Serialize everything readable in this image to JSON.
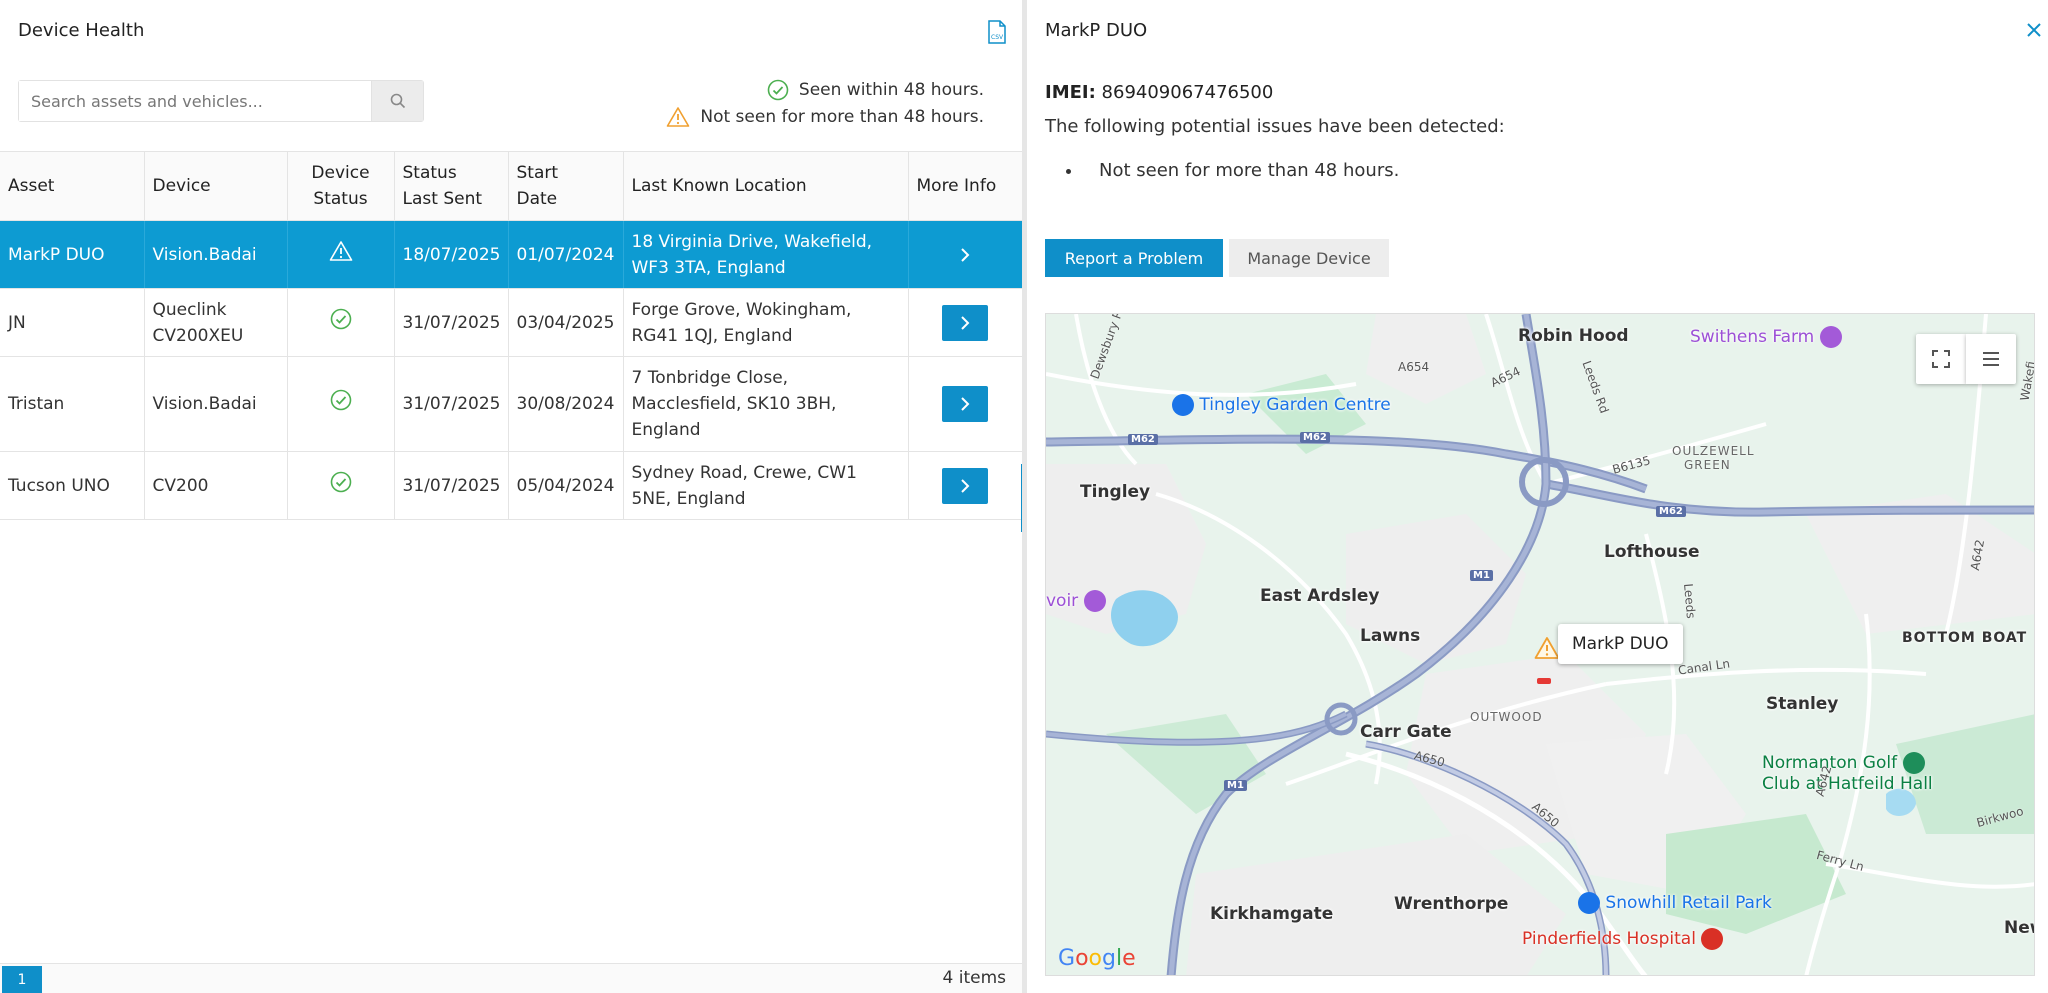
{
  "left": {
    "title": "Device Health",
    "search_placeholder": "Search assets and vehicles...",
    "legend": {
      "seen": "Seen within 48 hours.",
      "not_seen": "Not seen for more than 48 hours."
    },
    "columns": {
      "asset": "Asset",
      "device": "Device",
      "device_status_1": "Device",
      "device_status_2": "Status",
      "status_last_sent_1": "Status",
      "status_last_sent_2": "Last Sent",
      "start_date_1": "Start",
      "start_date_2": "Date",
      "last_known_location": "Last Known Location",
      "more_info": "More Info"
    },
    "rows": [
      {
        "asset": "MarkP DUO",
        "device": "Vision.Badai",
        "status": "warning",
        "last_sent": "18/07/2025",
        "start_date": "01/07/2024",
        "location": "18 Virginia Drive, Wakefield, WF3 3TA, England"
      },
      {
        "asset": "JN",
        "device": "Queclink CV200XEU",
        "status": "ok",
        "last_sent": "31/07/2025",
        "start_date": "03/04/2025",
        "location": "Forge Grove, Wokingham, RG41 1QJ, England"
      },
      {
        "asset": "Tristan",
        "device": "Vision.Badai",
        "status": "ok",
        "last_sent": "31/07/2025",
        "start_date": "30/08/2024",
        "location": "7 Tonbridge Close, Macclesfield, SK10 3BH, England"
      },
      {
        "asset": "Tucson UNO",
        "device": "CV200",
        "status": "ok",
        "last_sent": "31/07/2025",
        "start_date": "05/04/2024",
        "location": "Sydney Road, Crewe, CW1 5NE, England"
      }
    ],
    "pager": {
      "current_page": "1",
      "items": "4 items"
    }
  },
  "right": {
    "title": "MarkP DUO",
    "imei_label": "IMEI:",
    "imei_value": "869409067476500",
    "issues_intro": "The following potential issues have been detected:",
    "issues": [
      "Not seen for more than 48 hours."
    ],
    "report_button": "Report a Problem",
    "manage_button": "Manage Device",
    "map": {
      "tooltip": "MarkP DUO",
      "places": {
        "robin_hood": "Robin Hood",
        "tingley": "Tingley",
        "lofthouse": "Lofthouse",
        "east_ardsley": "East Ardsley",
        "lawns": "Lawns",
        "carr_gate": "Carr Gate",
        "stanley": "Stanley",
        "kirkhamgate": "Kirkhamgate",
        "wrenthorpe": "Wrenthorpe",
        "bottom_boat": "BOTTOM BOAT",
        "oulzewell_1": "OULZEWELL",
        "oulzewell_2": "GREEN",
        "outwood": "OUTWOOD",
        "newmillerdam_frag": "New",
        "voir_frag": "voir"
      },
      "pois": {
        "swithens_farm": "Swithens Farm",
        "tingley_garden_centre": "Tingley Garden Centre",
        "normanton_golf_1": "Normanton Golf",
        "normanton_golf_2": "Club at Hatfeild Hall",
        "snowhill_retail_park": "Snowhill Retail Park",
        "pinderfields_hospital": "Pinderfields Hospital"
      },
      "roads": {
        "a654_1": "A654",
        "a654_2": "A654",
        "leeds_rd": "Leeds Rd",
        "b6135": "B6135",
        "canal_ln": "Canal Ln",
        "a650_1": "A650",
        "a650_2": "A650",
        "a642_1": "A642",
        "a642_2": "A642",
        "ferry_ln": "Ferry Ln",
        "birkwood": "Birkwoo",
        "dewsbury_rd": "Dewsbury Rd",
        "wakefield_rd": "Wakefi",
        "leeds_v": "Leeds"
      },
      "shields": {
        "m62_a": "M62",
        "m62_b": "M62",
        "m62_c": "M62",
        "m1_a": "M1",
        "m1_b": "M1"
      },
      "google": "Google"
    }
  },
  "colors": {
    "accent": "#0f8fc9",
    "selected_row": "#0d9bd2",
    "ok_green": "#4caf50",
    "warning_amber": "#f0a030"
  }
}
